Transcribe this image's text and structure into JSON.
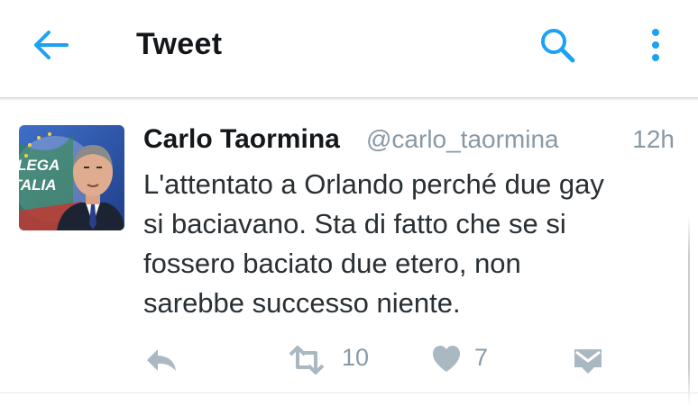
{
  "header": {
    "title": "Tweet",
    "back_icon": "arrow-left-icon",
    "search_icon": "search-icon",
    "more_icon": "more-vertical-icon",
    "accent": "#1da1f2"
  },
  "tweet": {
    "author_name": "Carlo Taormina",
    "handle": "@carlo_taormina",
    "time": "12h",
    "avatar": {
      "logo_text": [
        "LEGA",
        "ITALIA"
      ]
    },
    "text_lines": [
      "L'attentato a Orlando perché due gay",
      "si baciavano. Sta di fatto che se si",
      "fossero baciato due etero, non",
      "sarebbe successo niente."
    ],
    "actions": {
      "reply_icon": "reply-icon",
      "retweet_icon": "retweet-icon",
      "retweet_count": "10",
      "like_icon": "heart-icon",
      "like_count": "7",
      "dm_icon": "direct-message-icon",
      "icon_color": "#aab8c2"
    }
  }
}
